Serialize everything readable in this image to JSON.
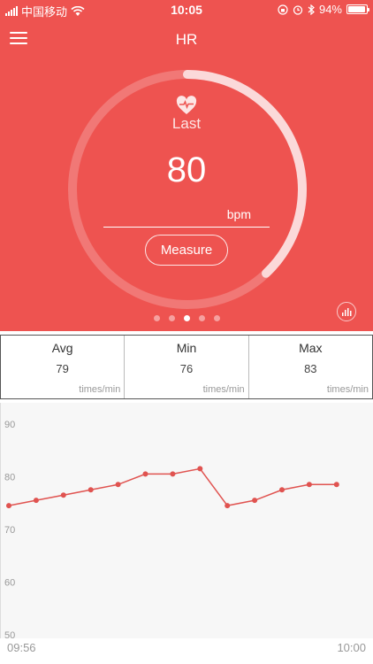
{
  "status_bar": {
    "carrier": "中国移动",
    "time": "10:05",
    "battery": "94%",
    "battery_level": 0.94
  },
  "header": {
    "title": "HR"
  },
  "reading": {
    "label": "Last",
    "value": "80",
    "unit": "bpm",
    "gauge_fraction": 0.38
  },
  "measure_button": "Measure",
  "pager": {
    "count": 5,
    "active": 2
  },
  "stats": [
    {
      "label": "Avg",
      "value": "79",
      "unit": "times/min"
    },
    {
      "label": "Min",
      "value": "76",
      "unit": "times/min"
    },
    {
      "label": "Max",
      "value": "83",
      "unit": "times/min"
    }
  ],
  "colors": {
    "accent": "#ee5350",
    "line": "#e05350"
  },
  "chart_data": {
    "type": "line",
    "y_ticks": [
      90,
      80,
      70,
      60,
      50
    ],
    "ylim": [
      50,
      94
    ],
    "x_start": "09:56",
    "x_end": "10:00",
    "values": [
      74.5,
      75.5,
      76.5,
      77.5,
      78.5,
      80.5,
      80.5,
      81.5,
      74.5,
      75.5,
      77.5,
      78.5,
      78.5
    ],
    "grid": false
  }
}
